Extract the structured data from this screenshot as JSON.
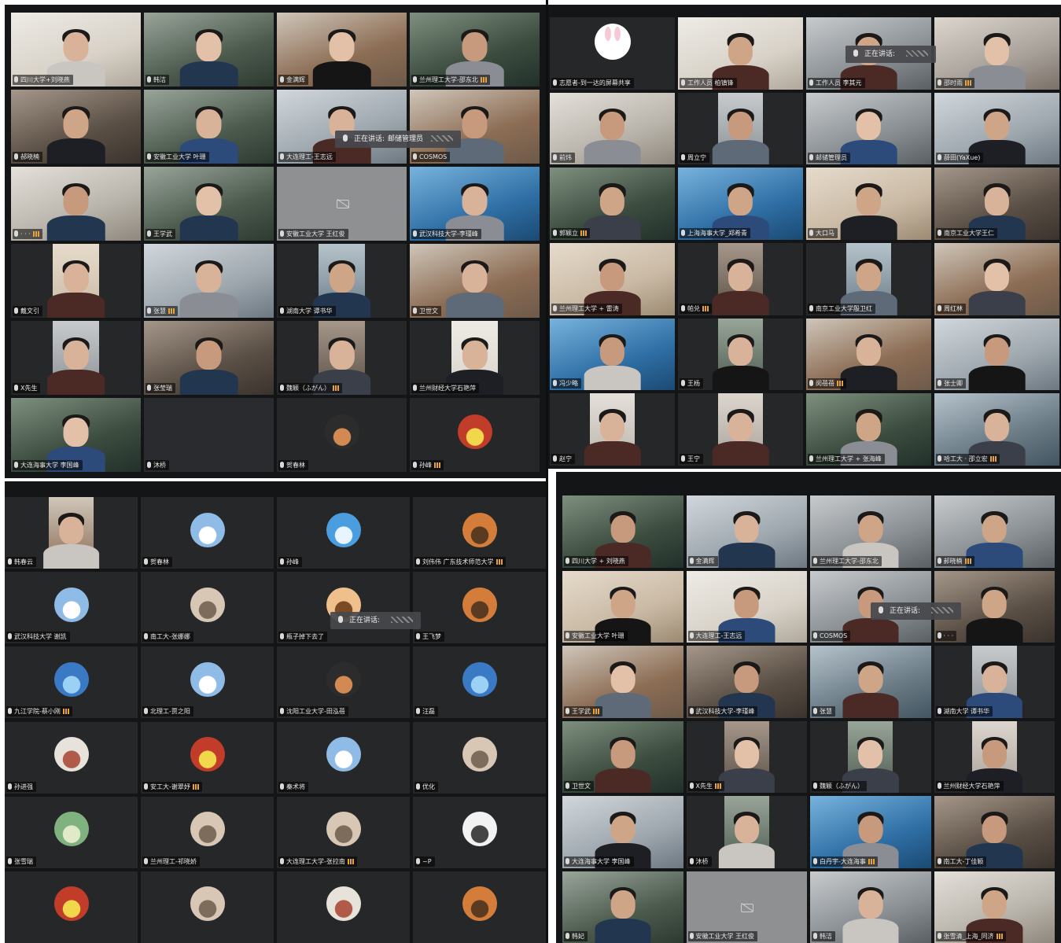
{
  "panels": {
    "top_left": {
      "tiles": [
        {
          "name": "四川大学+刘晓燕",
          "scene": "video"
        },
        {
          "name": "韩洁",
          "scene": "video"
        },
        {
          "name": "金满辉",
          "scene": "video"
        },
        {
          "name": "兰州理工大学-邵东北",
          "scene": "video"
        },
        {
          "name": "郝晓楠",
          "scene": "video"
        },
        {
          "name": "安徽工业大学 叶珊",
          "scene": "video"
        },
        {
          "name": "大连理工-王志远",
          "scene": "video"
        },
        {
          "name": "COSMOS",
          "scene": "video"
        },
        {
          "name": "· · ·",
          "scene": "video"
        },
        {
          "name": "王学武",
          "scene": "video"
        },
        {
          "name": "安徽工业大学 王红俊",
          "scene": "camoff"
        },
        {
          "name": "武汉科技大学-李瑾峰",
          "scene": "video"
        },
        {
          "name": "戴文引",
          "scene": "pillar"
        },
        {
          "name": "张慧",
          "scene": "video"
        },
        {
          "name": "湖南大学 谭书华",
          "scene": "pillar"
        },
        {
          "name": "卫世文",
          "scene": "video"
        },
        {
          "name": "X先生",
          "scene": "pillar"
        },
        {
          "name": "张莹瑞",
          "scene": "video"
        },
        {
          "name": "魏颖（ふがん）",
          "scene": "pillar"
        },
        {
          "name": "兰州财经大学石艳萍",
          "scene": "pillar"
        },
        {
          "name": "大连海事大学 李国峰",
          "scene": "video"
        },
        {
          "name": "沐桥",
          "scene": "empty"
        },
        {
          "name": "贺春林",
          "scene": "avatar"
        },
        {
          "name": "孙峰",
          "scene": "avatar"
        }
      ],
      "speaking": {
        "label": "正在讲话:",
        "who": "邮储管理员"
      }
    },
    "top_right": {
      "tiles": [
        {
          "name": "志愿者-到一达的屏幕共享",
          "scene": "avatar"
        },
        {
          "name": "工作人员 柏镇锋",
          "scene": "video"
        },
        {
          "name": "工作人员 李其元",
          "scene": "video"
        },
        {
          "name": "邵时雨",
          "scene": "video"
        },
        {
          "name": "前炜",
          "scene": "video"
        },
        {
          "name": "周立宁",
          "scene": "pillar"
        },
        {
          "name": "邮储管理员",
          "scene": "video"
        },
        {
          "name": "薛田(YaXue)",
          "scene": "video"
        },
        {
          "name": "郭颖立",
          "scene": "video"
        },
        {
          "name": "上海海事大学_郑希青",
          "scene": "video"
        },
        {
          "name": "大口马",
          "scene": "video"
        },
        {
          "name": "南京工业大学王仁",
          "scene": "video"
        },
        {
          "name": "兰州理工大学 + 雷涛",
          "scene": "video"
        },
        {
          "name": "帕兑",
          "scene": "pillar"
        },
        {
          "name": "南京工业大学殷卫红",
          "scene": "pillar"
        },
        {
          "name": "周红林",
          "scene": "video"
        },
        {
          "name": "冯少略",
          "scene": "video"
        },
        {
          "name": "王杨",
          "scene": "pillar"
        },
        {
          "name": "闵蓓蓓",
          "scene": "video"
        },
        {
          "name": "张士卿",
          "scene": "video"
        },
        {
          "name": "赵宁",
          "scene": "pillar"
        },
        {
          "name": "王宁",
          "scene": "pillar"
        },
        {
          "name": "兰州理工大学 + 张海峰",
          "scene": "video"
        },
        {
          "name": "哈工大 · 邵立宏",
          "scene": "video"
        }
      ],
      "speaking": {
        "label": "正在讲话:",
        "who": ""
      }
    },
    "bottom_left": {
      "tiles": [
        {
          "name": "韩春云",
          "scene": "pillar"
        },
        {
          "name": "贺春林",
          "scene": "avatar"
        },
        {
          "name": "孙峰",
          "scene": "avatar"
        },
        {
          "name": "刘伟伟 广东技术师范大学",
          "scene": "avatar"
        },
        {
          "name": "武汉科技大学 谢凯",
          "scene": "avatar"
        },
        {
          "name": "南工大-张娜娜",
          "scene": "avatar"
        },
        {
          "name": "瓶子掉下去了",
          "scene": "avatar"
        },
        {
          "name": "王飞梦",
          "scene": "avatar"
        },
        {
          "name": "九江学院-蔡小刚",
          "scene": "avatar"
        },
        {
          "name": "北理工-贾之阳",
          "scene": "avatar"
        },
        {
          "name": "沈阳工业大学-田泓蓓",
          "scene": "avatar"
        },
        {
          "name": "汪磊",
          "scene": "avatar"
        },
        {
          "name": "孙进强",
          "scene": "avatar"
        },
        {
          "name": "安工大-谢翠妤",
          "scene": "avatar"
        },
        {
          "name": "秦术将",
          "scene": "avatar"
        },
        {
          "name": "优化",
          "scene": "avatar"
        },
        {
          "name": "张雪瑞",
          "scene": "avatar"
        },
        {
          "name": "兰州理工-祁晓娇",
          "scene": "avatar"
        },
        {
          "name": "大连理工大学-张拉南",
          "scene": "avatar"
        },
        {
          "name": "~P",
          "scene": "avatar"
        },
        {
          "name": "",
          "scene": "avatar"
        },
        {
          "name": "",
          "scene": "avatar"
        },
        {
          "name": "",
          "scene": "avatar"
        },
        {
          "name": "",
          "scene": "avatar"
        }
      ],
      "speaking": {
        "label": "正在讲话:",
        "who": ""
      }
    },
    "bottom_right": {
      "tiles": [
        {
          "name": "四川大学 + 刘晓燕",
          "scene": "video"
        },
        {
          "name": "金满辉",
          "scene": "video"
        },
        {
          "name": "兰州理工大学-邵东北",
          "scene": "video"
        },
        {
          "name": "郝晓楠",
          "scene": "video"
        },
        {
          "name": "安徽工业大学 叶珊",
          "scene": "video"
        },
        {
          "name": "大连理工-王志远",
          "scene": "video"
        },
        {
          "name": "COSMOS",
          "scene": "video"
        },
        {
          "name": "· · ·",
          "scene": "video"
        },
        {
          "name": "王学武",
          "scene": "video"
        },
        {
          "name": "武汉科技大学-李瑾峰",
          "scene": "video"
        },
        {
          "name": "张慧",
          "scene": "video"
        },
        {
          "name": "湖南大学 谭书华",
          "scene": "pillar"
        },
        {
          "name": "卫世文",
          "scene": "video"
        },
        {
          "name": "X先生",
          "scene": "pillar"
        },
        {
          "name": "魏颖（ふがん）",
          "scene": "pillar"
        },
        {
          "name": "兰州财经大学石艳萍",
          "scene": "pillar"
        },
        {
          "name": "大连海事大学 李国峰",
          "scene": "video"
        },
        {
          "name": "沐桥",
          "scene": "pillar"
        },
        {
          "name": "白丹宇-大连海事",
          "scene": "video"
        },
        {
          "name": "南工大-丁佳颖",
          "scene": "video"
        },
        {
          "name": "韩妃",
          "scene": "video"
        },
        {
          "name": "安徽工业大学 王红俊",
          "scene": "camoff"
        },
        {
          "name": "韩洁",
          "scene": "video"
        },
        {
          "name": "张雪清_上海_同济",
          "scene": "video"
        }
      ],
      "speaking": {
        "label": "正在讲话:",
        "who": ""
      }
    }
  },
  "colors": {
    "panel_bg": "#141517",
    "tile_bg": "#262729",
    "accent_blue": "#2b7bd3",
    "signal_orange": "#e6a23c"
  }
}
